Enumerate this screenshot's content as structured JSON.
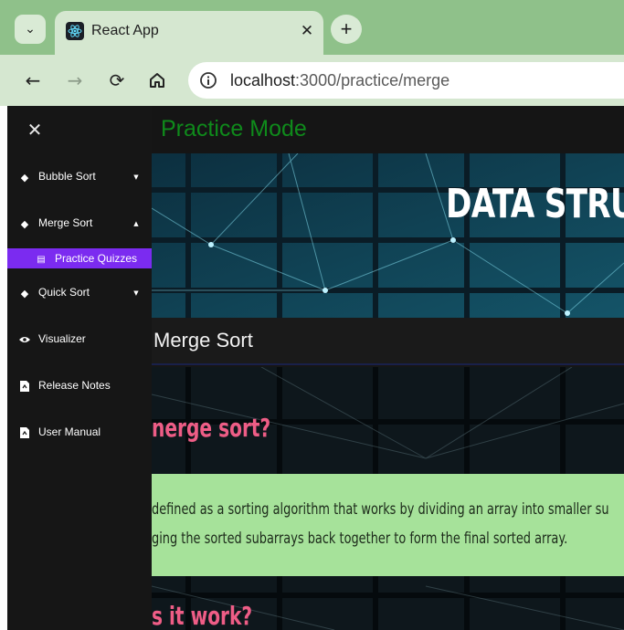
{
  "browser": {
    "tab_title": "React App",
    "url_host": "localhost",
    "url_rest": ":3000/practice/merge"
  },
  "page": {
    "title": "Practice Mode",
    "banner_text": "DATA STRU",
    "section_title": "Merge Sort",
    "question1": "nerge sort?",
    "answer_line1": "defined as a sorting algorithm that works by dividing an array into smaller su",
    "answer_line2": "ging the sorted subarrays back together to form the final sorted array.",
    "question2": "s it work?"
  },
  "sidebar": {
    "items": [
      {
        "label": "Bubble Sort",
        "icon": "diamond-icon",
        "expandable": true,
        "expanded": false
      },
      {
        "label": "Merge Sort",
        "icon": "diamond-icon",
        "expandable": true,
        "expanded": true
      },
      {
        "label": "Quick Sort",
        "icon": "diamond-icon",
        "expandable": true,
        "expanded": false
      },
      {
        "label": "Visualizer",
        "icon": "eye-icon",
        "expandable": false
      },
      {
        "label": "Release Notes",
        "icon": "document-icon",
        "expandable": false
      },
      {
        "label": "User Manual",
        "icon": "document-icon",
        "expandable": false
      }
    ],
    "subitem": {
      "label": "Practice Quizzes",
      "icon": "list-icon",
      "active": true
    }
  },
  "colors": {
    "chrome_accent": "#8fc18a",
    "title_green": "#0f8a1b",
    "sidebar_active": "#7b2bf0",
    "question_pink": "#ee5d86",
    "answer_bg": "#a6e29a"
  }
}
